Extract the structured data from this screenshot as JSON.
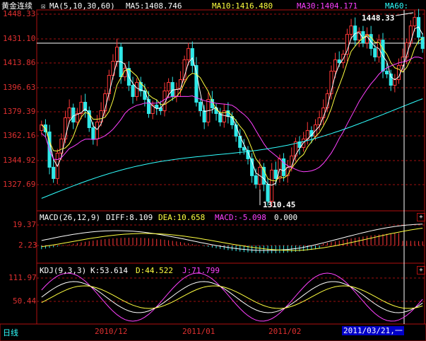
{
  "main": {
    "instrument": "黄金连续",
    "ma_title": "MA(5,10,30,60)",
    "ma5_label": "MA5:1408.746",
    "ma10_label": "MA10:1416.480",
    "ma30_label": "MA30:1404.171",
    "ma60_label": "MA60:",
    "y_ticks": [
      "1448.33",
      "1431.10",
      "1413.86",
      "1396.63",
      "1379.39",
      "1362.16",
      "1344.92",
      "1327.69"
    ],
    "high_label": "1448.33",
    "low_label": "1310.45"
  },
  "macd": {
    "title": "MACD(26,12,9)",
    "diff": "DIFF:8.109",
    "dea": "DEA:10.658",
    "macd": "MACD:-5.098",
    "extra": "0.000",
    "y_ticks": [
      "19.37",
      "2.23"
    ]
  },
  "kdj": {
    "title": "KDJ(9,3,3)",
    "k": "K:53.614",
    "d": "D:44.522",
    "j": "J:71.799",
    "y_ticks": [
      "111.97",
      "50.44"
    ]
  },
  "bottom": {
    "period": "日线",
    "dates": [
      "2010/12",
      "2011/01",
      "2011/02"
    ],
    "cursor_date": "2011/03/21,一"
  },
  "colors": {
    "up": "#ff3838",
    "down": "#30e8e8",
    "ma5": "#ffffff",
    "ma10": "#ffff40",
    "ma30": "#ff40ff",
    "ma60": "#30ffff",
    "grid": "#a01010",
    "frame": "#b01010"
  },
  "chart_data": {
    "type": "candlestick",
    "ylim": [
      1305,
      1452
    ],
    "high": 1448.33,
    "low": 1310.45,
    "closes": [
      1370,
      1365,
      1340,
      1332,
      1350,
      1360,
      1375,
      1382,
      1372,
      1378,
      1386,
      1380,
      1368,
      1360,
      1372,
      1380,
      1392,
      1405,
      1415,
      1425,
      1404,
      1410,
      1398,
      1390,
      1400,
      1394,
      1388,
      1378,
      1384,
      1382,
      1380,
      1394,
      1400,
      1390,
      1395,
      1402,
      1416,
      1424,
      1412,
      1386,
      1380,
      1372,
      1388,
      1382,
      1378,
      1372,
      1380,
      1376,
      1370,
      1362,
      1354,
      1352,
      1346,
      1334,
      1328,
      1340,
      1328,
      1316,
      1338,
      1332,
      1346,
      1334,
      1340,
      1348,
      1358,
      1354,
      1360,
      1366,
      1362,
      1370,
      1375,
      1382,
      1392,
      1408,
      1416,
      1414,
      1420,
      1434,
      1440,
      1430,
      1436,
      1428,
      1434,
      1424,
      1418,
      1430,
      1408,
      1406,
      1398,
      1402,
      1412,
      1418,
      1428,
      1440,
      1446,
      1432,
      1424
    ]
  }
}
